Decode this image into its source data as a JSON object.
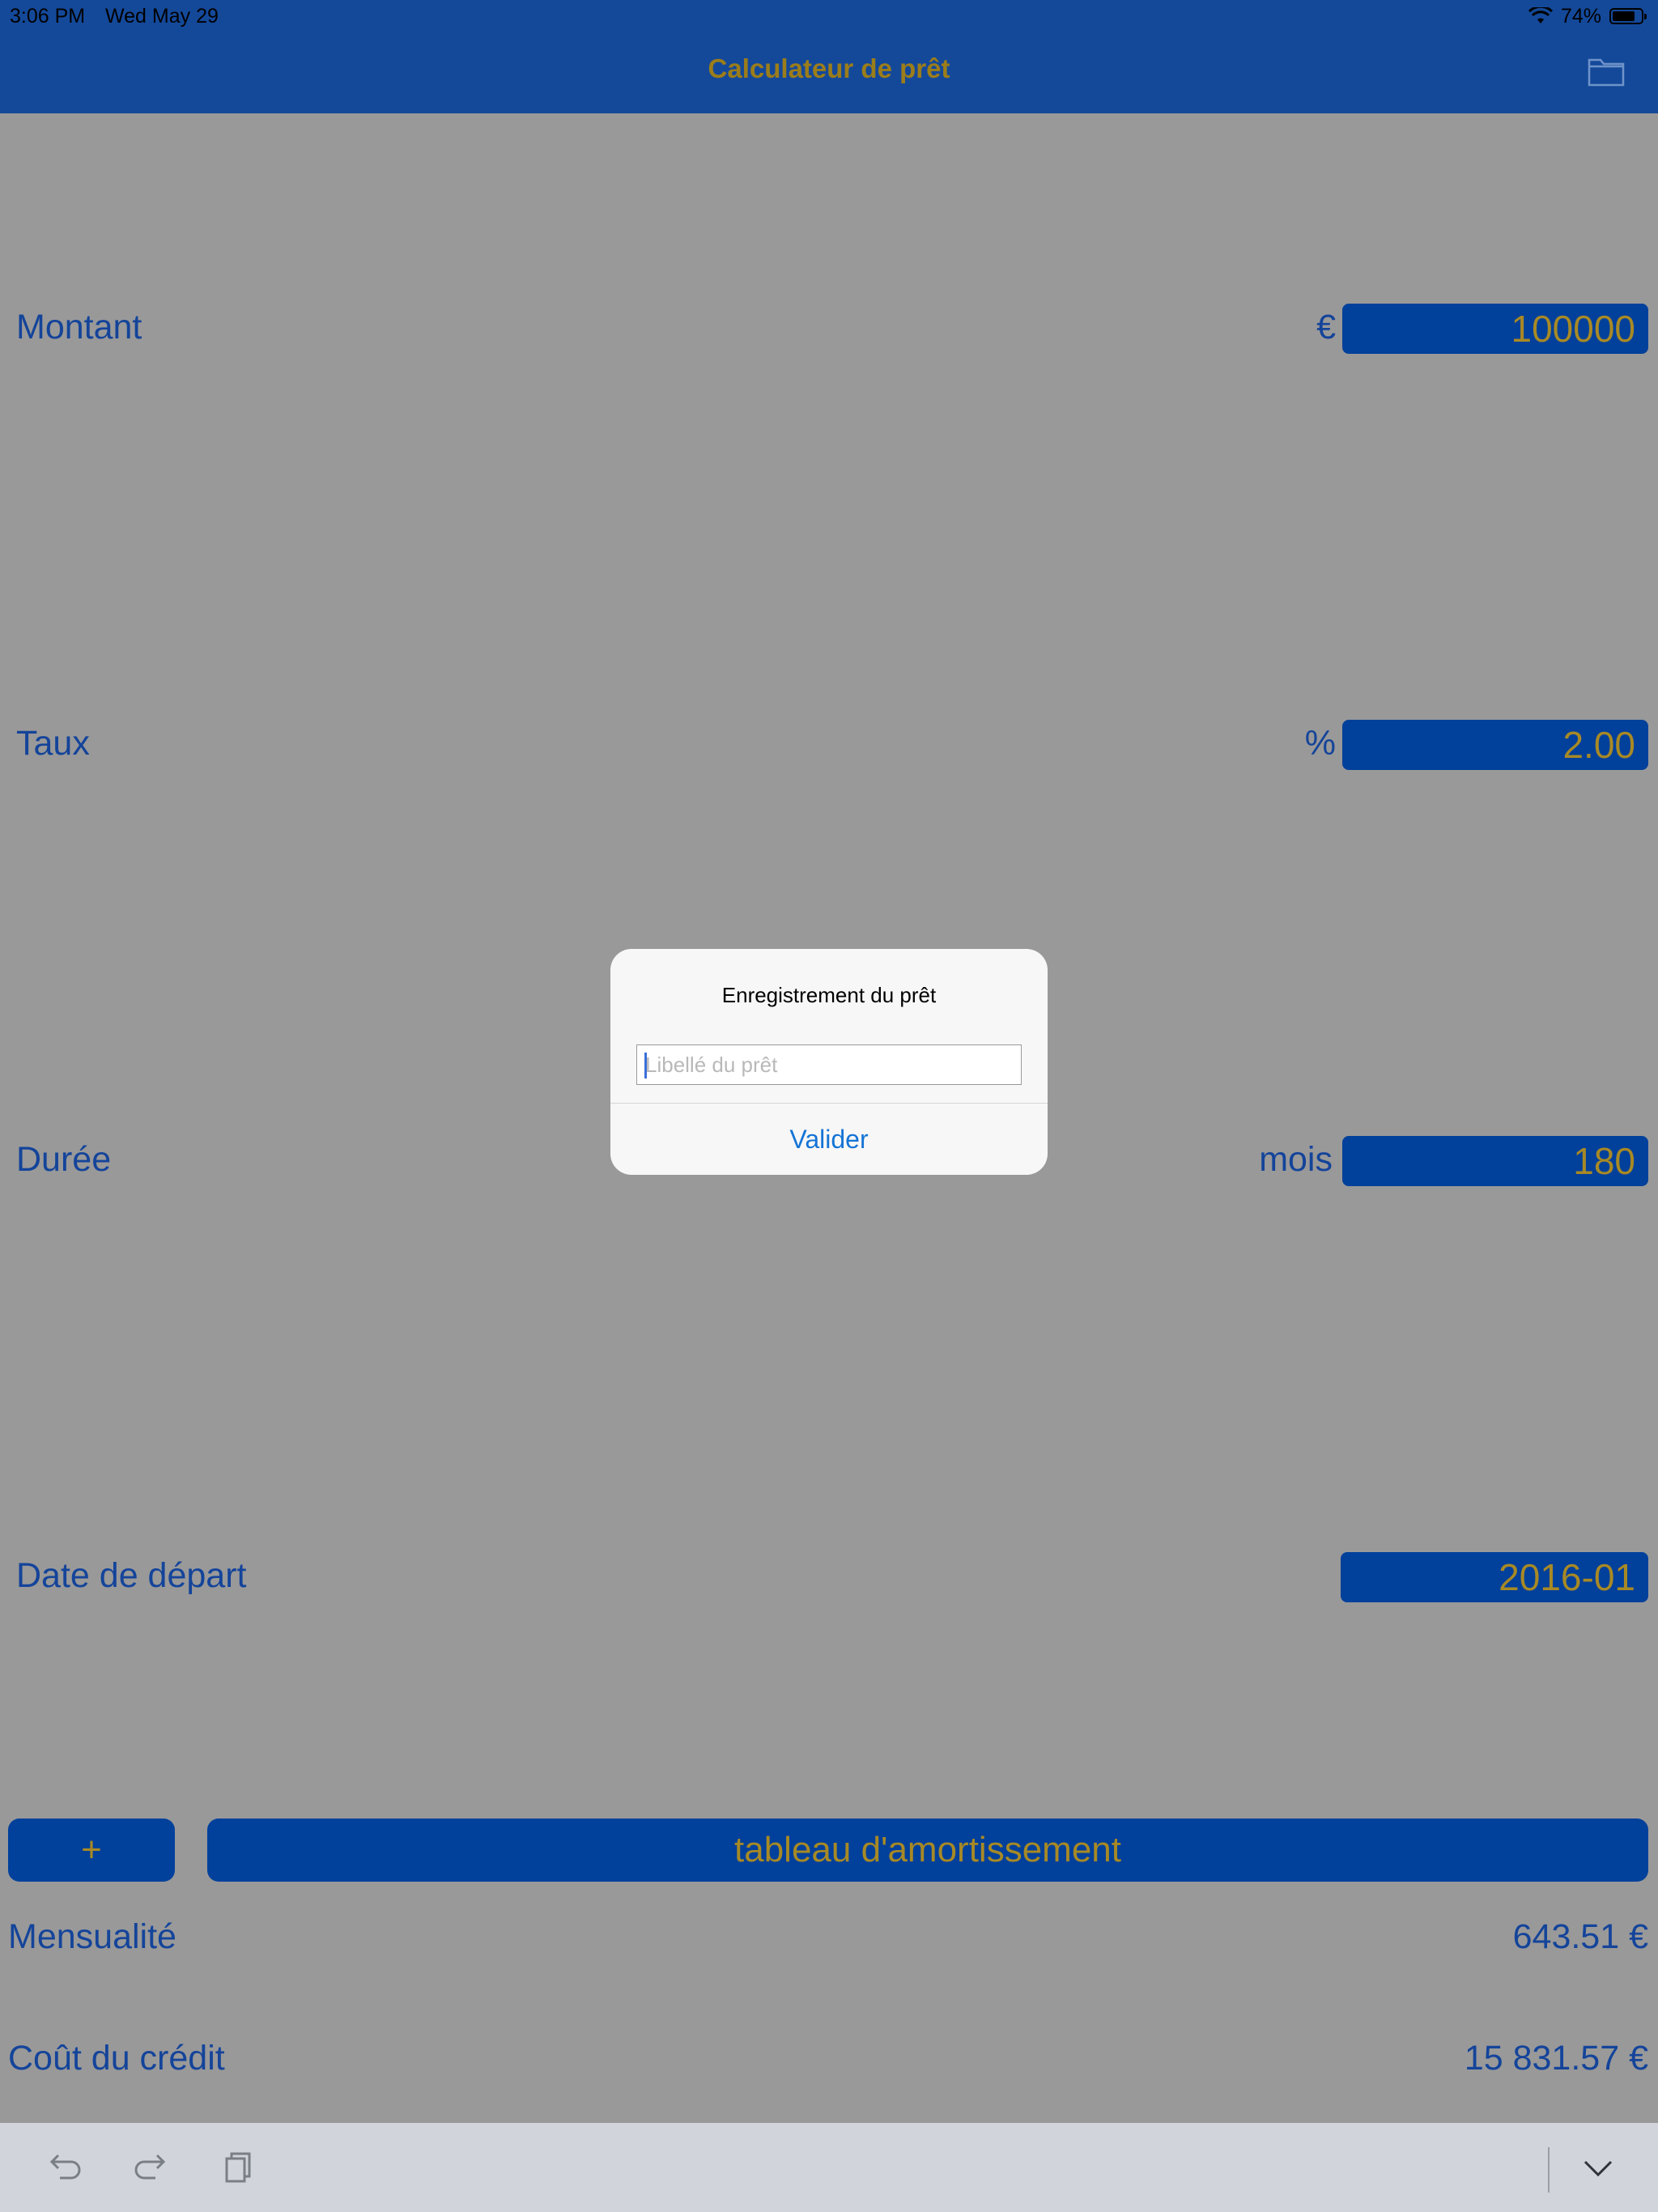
{
  "status_bar": {
    "time": "3:06 PM",
    "date": "Wed May 29",
    "battery": "74%"
  },
  "nav": {
    "title": "Calculateur de prêt",
    "icon": "folder-icon"
  },
  "fields": {
    "montant": {
      "label": "Montant",
      "unit": "€",
      "value": "100000"
    },
    "taux": {
      "label": "Taux",
      "unit": "%",
      "value": "2.00"
    },
    "duree": {
      "label": "Durée",
      "unit": "mois",
      "value": "180"
    },
    "date": {
      "label": "Date de départ",
      "value": "2016-01"
    }
  },
  "buttons": {
    "add": "+",
    "table": "tableau d'amortissement"
  },
  "results": {
    "mensualite": {
      "label": "Mensualité",
      "value": "643.51 €"
    },
    "cout": {
      "label": "Coût du crédit",
      "value": "15 831.57 €"
    }
  },
  "toolbar": {
    "icons": [
      "undo-icon",
      "redo-icon",
      "clipboard-icon",
      "chevron-down-icon"
    ]
  },
  "dialog": {
    "title": "Enregistrement du prêt",
    "input_placeholder": "Libellé du prêt",
    "input_value": "",
    "confirm_label": "Valider"
  },
  "colors": {
    "nav_bg": "#14499a",
    "accent_gold": "#a78925",
    "field_bg": "#01409b",
    "text_blue": "#14449a",
    "overlay_bg": "#999999",
    "dialog_button": "#1574d6"
  }
}
